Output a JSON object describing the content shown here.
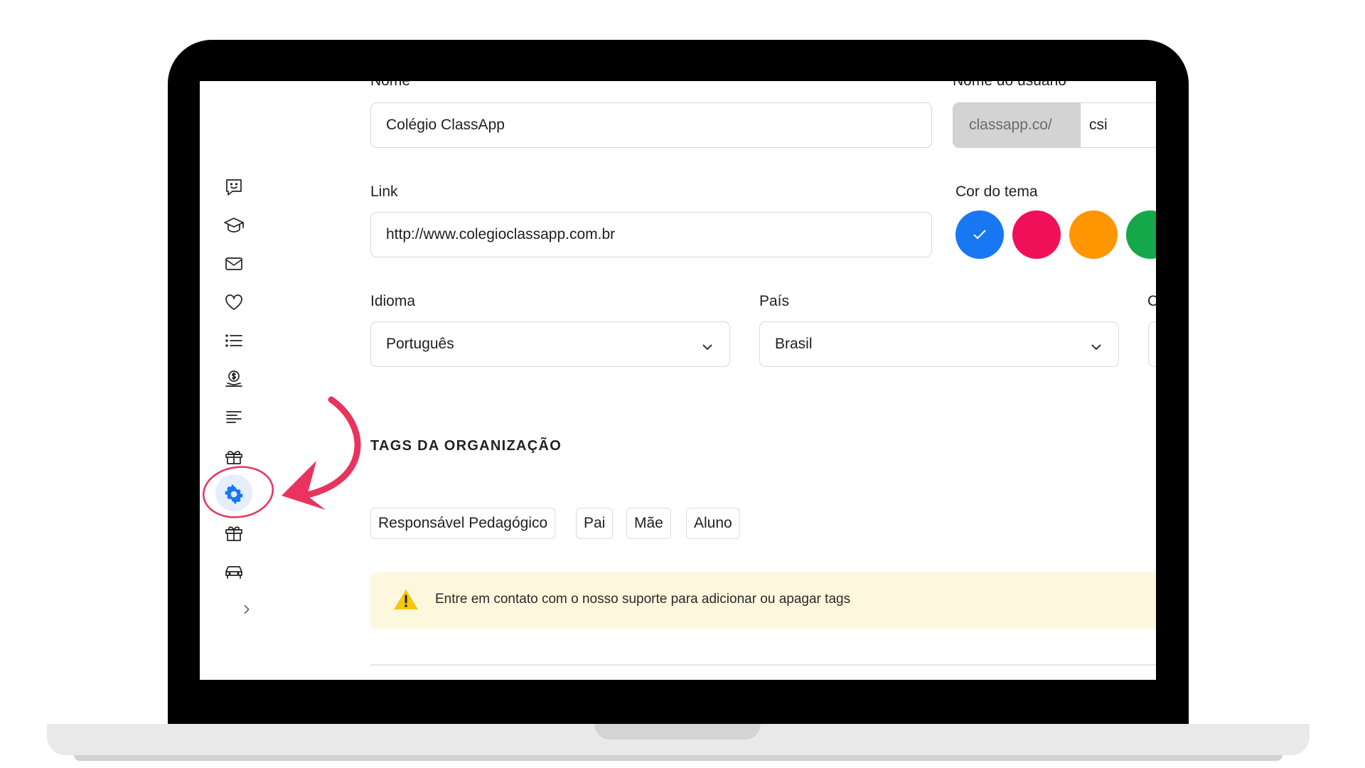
{
  "form": {
    "name_label": "Nome",
    "name_value": "Colégio ClassApp",
    "username_label": "Nome do usuário",
    "username_prefix": "classapp.co/",
    "username_value": "csi",
    "link_label": "Link",
    "link_value": "http://www.colegioclassapp.com.br",
    "theme_label": "Cor do tema",
    "theme_colors": [
      "#1877F2",
      "#F0105A",
      "#FF9500",
      "#14A84A"
    ],
    "language_label": "Idioma",
    "language_value": "Português",
    "country_label": "País",
    "country_value": "Brasil",
    "third_label_partial": "C"
  },
  "tags": {
    "title": "TAGS DA ORGANIZAÇÃO",
    "items": [
      "Responsável Pedagógico",
      "Pai",
      "Mãe",
      "Aluno"
    ]
  },
  "alert": {
    "text": "Entre em contato com o nosso suporte para adicionar ou apagar tags"
  },
  "sidebar": {
    "items": [
      {
        "icon": "chat-smile-icon"
      },
      {
        "icon": "graduation-cap-icon"
      },
      {
        "icon": "envelope-icon"
      },
      {
        "icon": "heart-icon"
      },
      {
        "icon": "list-icon"
      },
      {
        "icon": "money-hand-icon"
      },
      {
        "icon": "text-lines-icon"
      },
      {
        "icon": "box-icon"
      },
      {
        "icon": "gear-icon",
        "active": true
      },
      {
        "icon": "gift-icon"
      },
      {
        "icon": "car-icon"
      },
      {
        "icon": "chevron-right-icon"
      }
    ],
    "active_color": "#1877F2"
  },
  "annotation": {
    "color": "#E8345E"
  }
}
